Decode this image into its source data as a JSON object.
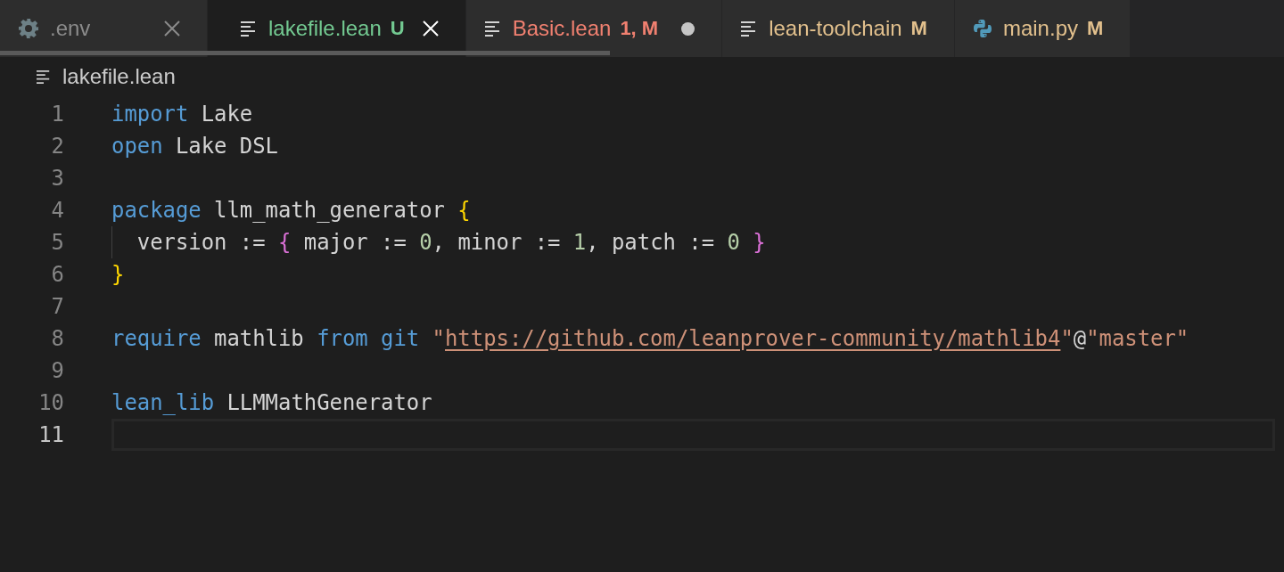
{
  "tabs": [
    {
      "kind": "settings",
      "label": ".env",
      "color": "#8b8b8b",
      "selected": false,
      "closable": true,
      "dirty": false
    },
    {
      "kind": "text",
      "label": "lakefile.lean",
      "badge": "U",
      "color": "#73c991",
      "selected": true,
      "closable": true,
      "dirty": false
    },
    {
      "kind": "text",
      "label": "Basic.lean",
      "badge": "1, M",
      "color": "#f08070",
      "selected": false,
      "closable": false,
      "dirty": true
    },
    {
      "kind": "text",
      "label": "lean-toolchain",
      "badge": "M",
      "color": "#e2c08d",
      "selected": false,
      "closable": false,
      "dirty": false
    },
    {
      "kind": "python",
      "label": "main.py",
      "badge": "M",
      "color": "#e2c08d",
      "selected": false,
      "closable": false,
      "dirty": false
    }
  ],
  "breadcrumb": {
    "label": "lakefile.lean"
  },
  "editor": {
    "lines": [
      {
        "number": "1",
        "current": false,
        "tokens": [
          {
            "kind": "keyword",
            "text": "import"
          },
          {
            "kind": "plain",
            "text": " Lake"
          }
        ]
      },
      {
        "number": "2",
        "current": false,
        "tokens": [
          {
            "kind": "keyword",
            "text": "open"
          },
          {
            "kind": "plain",
            "text": " Lake DSL"
          }
        ]
      },
      {
        "number": "3",
        "current": false
      },
      {
        "number": "4",
        "current": false,
        "tokens": [
          {
            "kind": "keyword",
            "text": "package"
          },
          {
            "kind": "plain",
            "text": " llm_math_generator "
          },
          {
            "kind": "bracket1",
            "text": "{"
          }
        ]
      },
      {
        "number": "5",
        "current": false,
        "tokens": [
          {
            "kind": "plain",
            "text": "  version := "
          },
          {
            "kind": "bracket2",
            "text": "{"
          },
          {
            "kind": "plain",
            "text": " major := "
          },
          {
            "kind": "number",
            "text": "0"
          },
          {
            "kind": "plain",
            "text": ", minor := "
          },
          {
            "kind": "number",
            "text": "1"
          },
          {
            "kind": "plain",
            "text": ", patch := "
          },
          {
            "kind": "number",
            "text": "0"
          },
          {
            "kind": "bracket2",
            "text": " }"
          }
        ]
      },
      {
        "number": "6",
        "current": false,
        "tokens": [
          {
            "kind": "bracket1",
            "text": "}"
          }
        ]
      },
      {
        "number": "7",
        "current": false
      },
      {
        "number": "8",
        "current": false,
        "tokens": [
          {
            "kind": "keyword",
            "text": "require"
          },
          {
            "kind": "plain",
            "text": " mathlib "
          },
          {
            "kind": "keyword",
            "text": "from git "
          },
          {
            "kind": "string",
            "text": "\""
          },
          {
            "kind": "link",
            "text": "https://github.com/leanprover-community/mathlib4"
          },
          {
            "kind": "string",
            "text": "\""
          },
          {
            "kind": "plain",
            "text": "@"
          },
          {
            "kind": "string",
            "text": "\"master\""
          }
        ]
      },
      {
        "number": "9",
        "current": false
      },
      {
        "number": "10",
        "current": false,
        "tokens": [
          {
            "kind": "keyword",
            "text": "lean_lib"
          },
          {
            "kind": "plain",
            "text": " LLMMathGenerator"
          }
        ]
      },
      {
        "number": "11",
        "current": true
      }
    ]
  }
}
